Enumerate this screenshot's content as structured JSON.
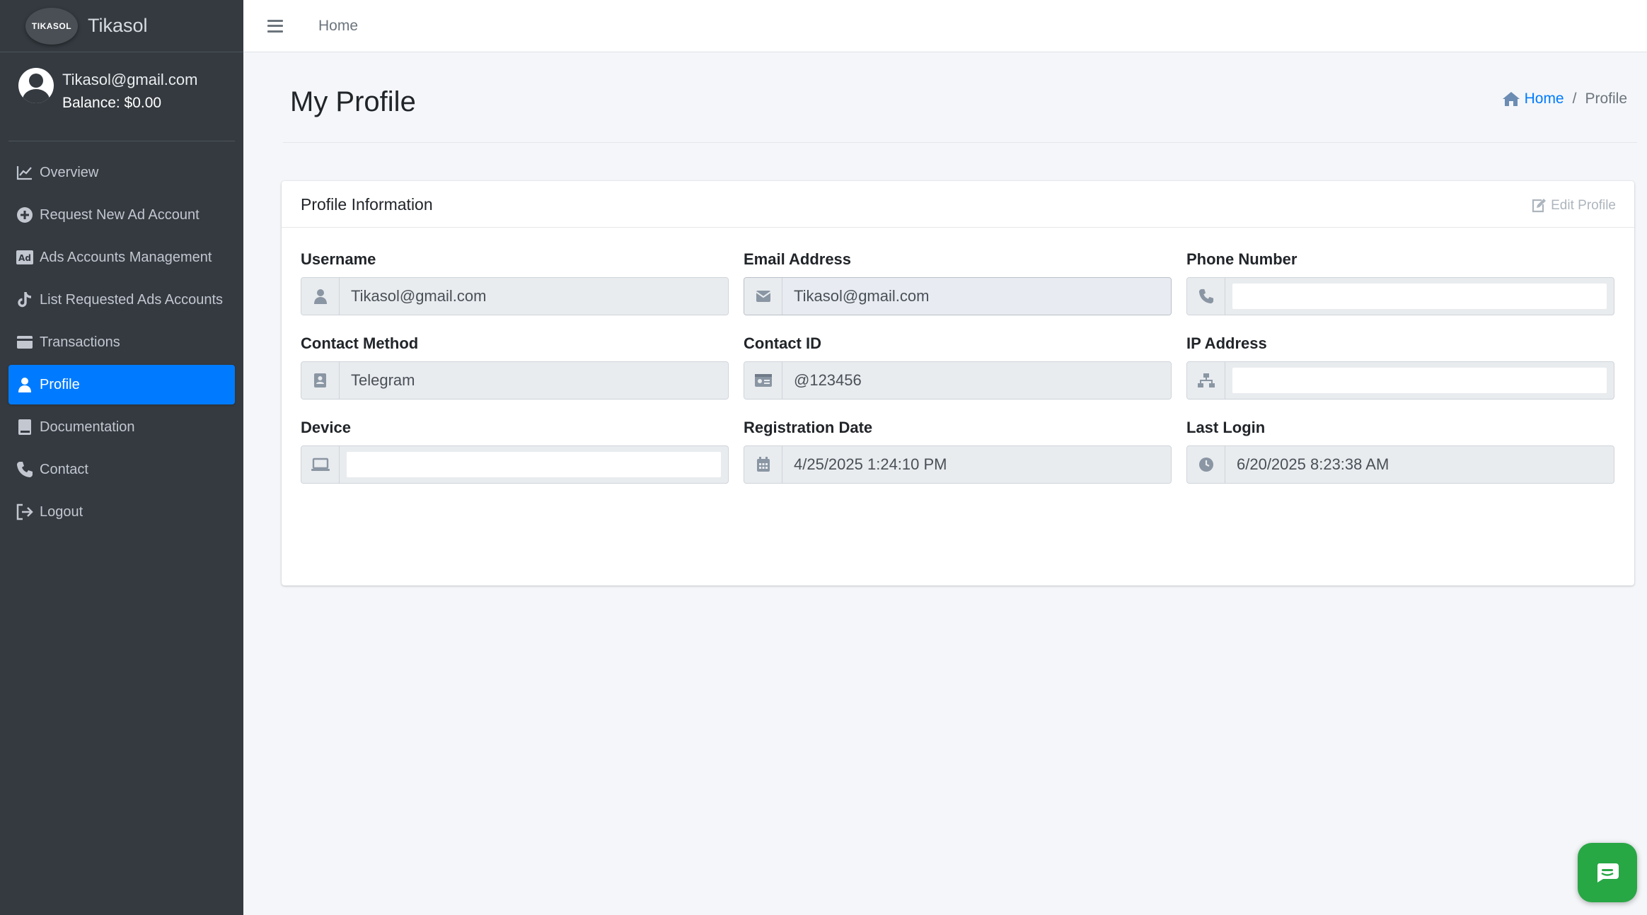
{
  "brand": {
    "name": "Tikasol",
    "logo_text": "TIKASOL"
  },
  "user": {
    "email": "Tikasol@gmail.com",
    "balance": "Balance: $0.00"
  },
  "nav": [
    {
      "label": "Overview",
      "icon": "chart-line-icon"
    },
    {
      "label": "Request New Ad Account",
      "icon": "plus-circle-icon"
    },
    {
      "label": "Ads Accounts Management",
      "icon": "ad-icon"
    },
    {
      "label": "List Requested Ads Accounts",
      "icon": "tiktok-icon"
    },
    {
      "label": "Transactions",
      "icon": "wallet-icon"
    },
    {
      "label": "Profile",
      "icon": "user-icon",
      "active": true
    },
    {
      "label": "Documentation",
      "icon": "book-icon"
    },
    {
      "label": "Contact",
      "icon": "phone-icon"
    },
    {
      "label": "Logout",
      "icon": "sign-out-icon"
    }
  ],
  "topbar": {
    "home_label": "Home"
  },
  "page": {
    "title": "My Profile",
    "breadcrumb": {
      "home": "Home",
      "separator": "/",
      "current": "Profile"
    }
  },
  "card": {
    "title": "Profile Information",
    "edit_label": "Edit Profile",
    "fields": {
      "username": {
        "label": "Username",
        "value": "Tikasol@gmail.com"
      },
      "email": {
        "label": "Email Address",
        "value": "Tikasol@gmail.com"
      },
      "phone": {
        "label": "Phone Number",
        "value": ""
      },
      "contact_method": {
        "label": "Contact Method",
        "value": "Telegram"
      },
      "contact_id": {
        "label": "Contact ID",
        "value": "@123456"
      },
      "ip": {
        "label": "IP Address",
        "value": ""
      },
      "device": {
        "label": "Device",
        "value": ""
      },
      "registration": {
        "label": "Registration Date",
        "value": "4/25/2025 1:24:10 PM"
      },
      "last_login": {
        "label": "Last Login",
        "value": "6/20/2025 8:23:38 AM"
      }
    }
  },
  "colors": {
    "sidebar": "#343a40",
    "accent": "#007bff",
    "chat": "#28a745"
  }
}
